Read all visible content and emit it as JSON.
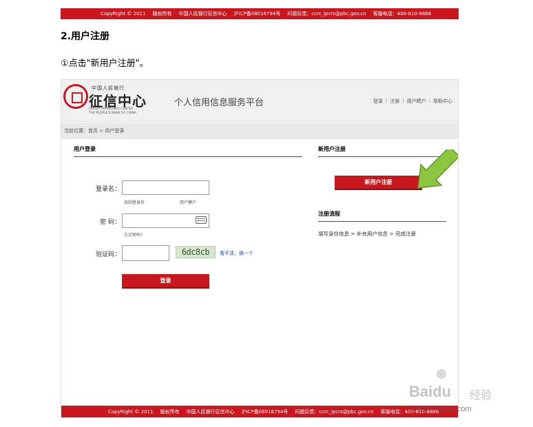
{
  "top_footer": {
    "items": [
      "CopyRight © 2011",
      "版权所有",
      "中国人民银行征信中心",
      "沪ICP备08016794号",
      "问题反馈：ccrc_ipcrs@pbc.gov.cn",
      "客服电话：400-810-8866"
    ]
  },
  "article": {
    "heading": "2.用户注册",
    "step": "①点击\"新用户注册\"。"
  },
  "site": {
    "logo_top": "中国人民银行",
    "logo_name": "征信中心",
    "logo_en1": "CREDIT REFERENCE CENTER",
    "logo_en2": "THE PEOPLE'S BANK OF CHINA",
    "platform_title": "个人信用信息服务平台",
    "top_links": [
      "登录",
      "注册",
      "用户聘户",
      "帮助中心"
    ],
    "breadcrumb": "当前位置：首页 > 用户登录"
  },
  "login": {
    "title": "用户登录",
    "username_label": "登录名：",
    "username_value": "",
    "find_login_link": "找回登录名",
    "user_account_link": "用户聘户",
    "password_label": "密  码：",
    "password_value": "",
    "forgot_password_link": "忘记密码？",
    "captcha_label": "验证码：",
    "captcha_value": "",
    "captcha_image_text": "6dc8cb",
    "captcha_refresh_link": "看不清，换一个",
    "login_button": "登录"
  },
  "register": {
    "title": "新用户注册",
    "button": "新用户注册",
    "flow_title": "注册流程",
    "flow_text": "填写身份信息 > 补充用户信息 > 完成注册"
  },
  "bottom_footer": {
    "items": [
      "CopyRight © 2011",
      "版权所有",
      "中国人民银行征信中心",
      "沪ICP备08016794号",
      "问题反馈：ccrc_ipcrs@pbc.gov.cn",
      "客服电话：400-810-8866"
    ]
  },
  "watermark": {
    "brand": "Baidu",
    "jy": "经验",
    "url": "jingyan.baidu.com"
  },
  "colors": {
    "brand_red": "#c8171e",
    "arrow_green": "#8cc63e"
  }
}
